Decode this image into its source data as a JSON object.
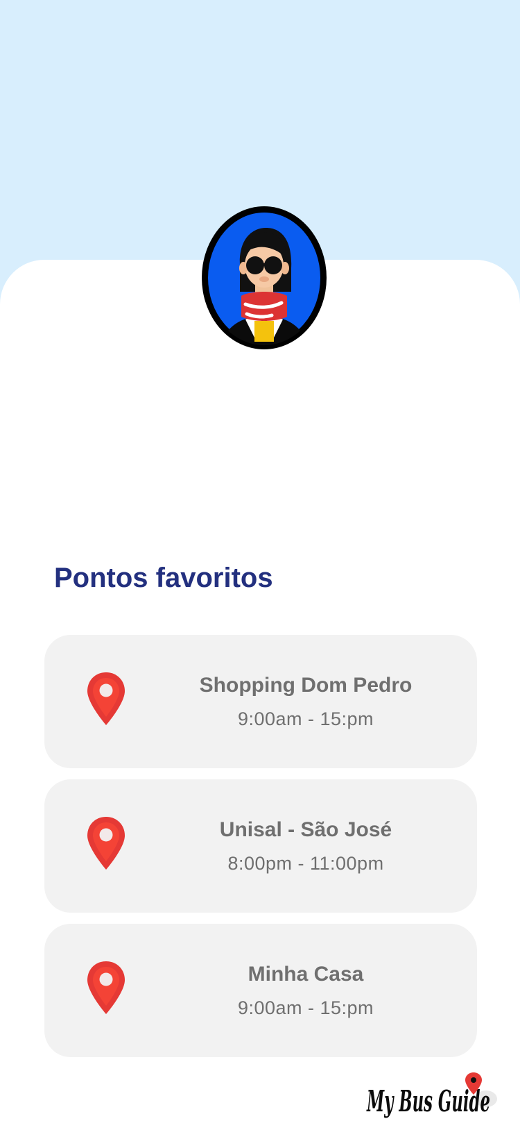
{
  "profile": {
    "avatar_icon": "user-avatar-illustration"
  },
  "favorites": {
    "title": "Pontos favoritos",
    "icon": "map-pin-icon",
    "items": [
      {
        "name": "Shopping Dom Pedro",
        "hours": "9:00am - 15:pm"
      },
      {
        "name": "Unisal - São José",
        "hours": "8:00pm - 11:00pm"
      },
      {
        "name": "Minha Casa",
        "hours": "9:00am - 15:pm"
      }
    ]
  },
  "brand": {
    "logo_text": "My Bus Guide"
  },
  "colors": {
    "top_background": "#d8eefd",
    "sheet_background": "#ffffff",
    "card_background": "#f2f2f2",
    "title": "#23307f",
    "card_text": "#6f6f6f",
    "pin": "#e53935"
  }
}
